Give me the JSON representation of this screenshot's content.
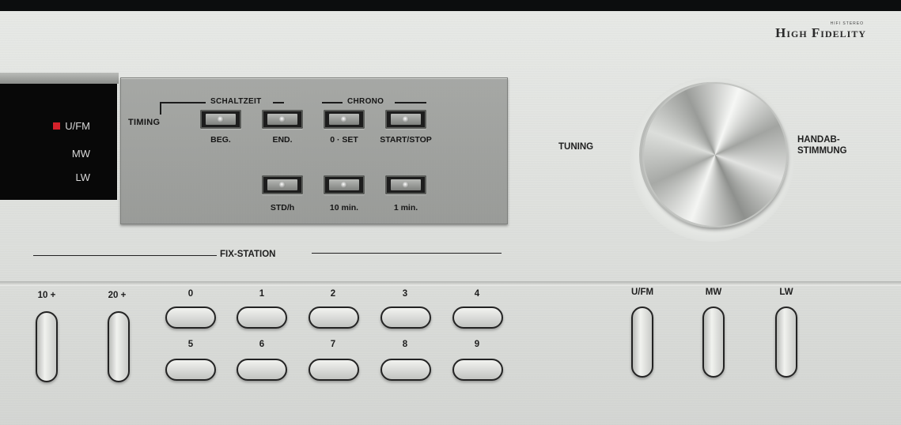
{
  "brand": {
    "name": "High Fidelity",
    "sub": "HIFI STEREO"
  },
  "band_display": [
    {
      "label": "U/FM",
      "active": true
    },
    {
      "label": "MW",
      "active": false
    },
    {
      "label": "LW",
      "active": false
    }
  ],
  "timing_panel": {
    "timing_label": "TIMING",
    "schaltzeit_label": "SCHALTZEIT",
    "chrono_label": "CHRONO",
    "row1": [
      "BEG.",
      "END.",
      "0 · SET",
      "START/STOP"
    ],
    "row2": [
      "STD/h",
      "10 min.",
      "1 min."
    ]
  },
  "tuning": {
    "left_label": "TUNING",
    "right_label_1": "HANDAB-",
    "right_label_2": "STIMMUNG"
  },
  "fix_station": {
    "label": "FIX-STATION",
    "tens": [
      "10 +",
      "20 +"
    ],
    "top_digits": [
      "0",
      "1",
      "2",
      "3",
      "4"
    ],
    "bottom_digits": [
      "5",
      "6",
      "7",
      "8",
      "9"
    ]
  },
  "band_buttons": [
    "U/FM",
    "MW",
    "LW"
  ],
  "colors": {
    "led_red": "#d4212a",
    "faceplate": "#e3e5e2",
    "panel": "#a3a5a2"
  }
}
